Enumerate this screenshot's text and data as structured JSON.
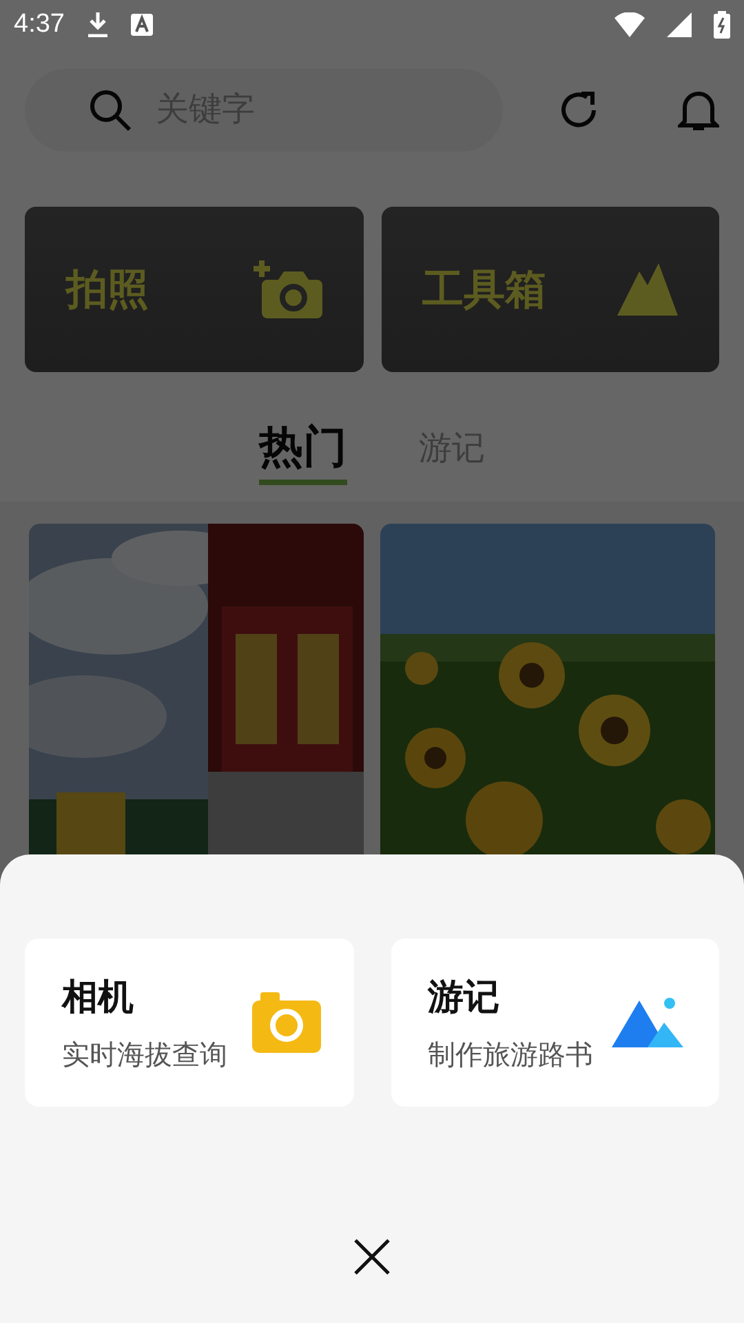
{
  "status_bar": {
    "time": "4:37"
  },
  "search": {
    "placeholder": "关键字"
  },
  "action_cards": [
    {
      "label": "拍照",
      "kind": "camera"
    },
    {
      "label": "工具箱",
      "kind": "mountain"
    }
  ],
  "tabs": [
    {
      "label": "热门",
      "selected": true
    },
    {
      "label": "游记",
      "selected": false
    }
  ],
  "sheet": {
    "options": [
      {
        "title": "相机",
        "subtitle": "实时海拔查询",
        "kind": "camera"
      },
      {
        "title": "游记",
        "subtitle": "制作旅游路书",
        "kind": "album"
      }
    ]
  }
}
